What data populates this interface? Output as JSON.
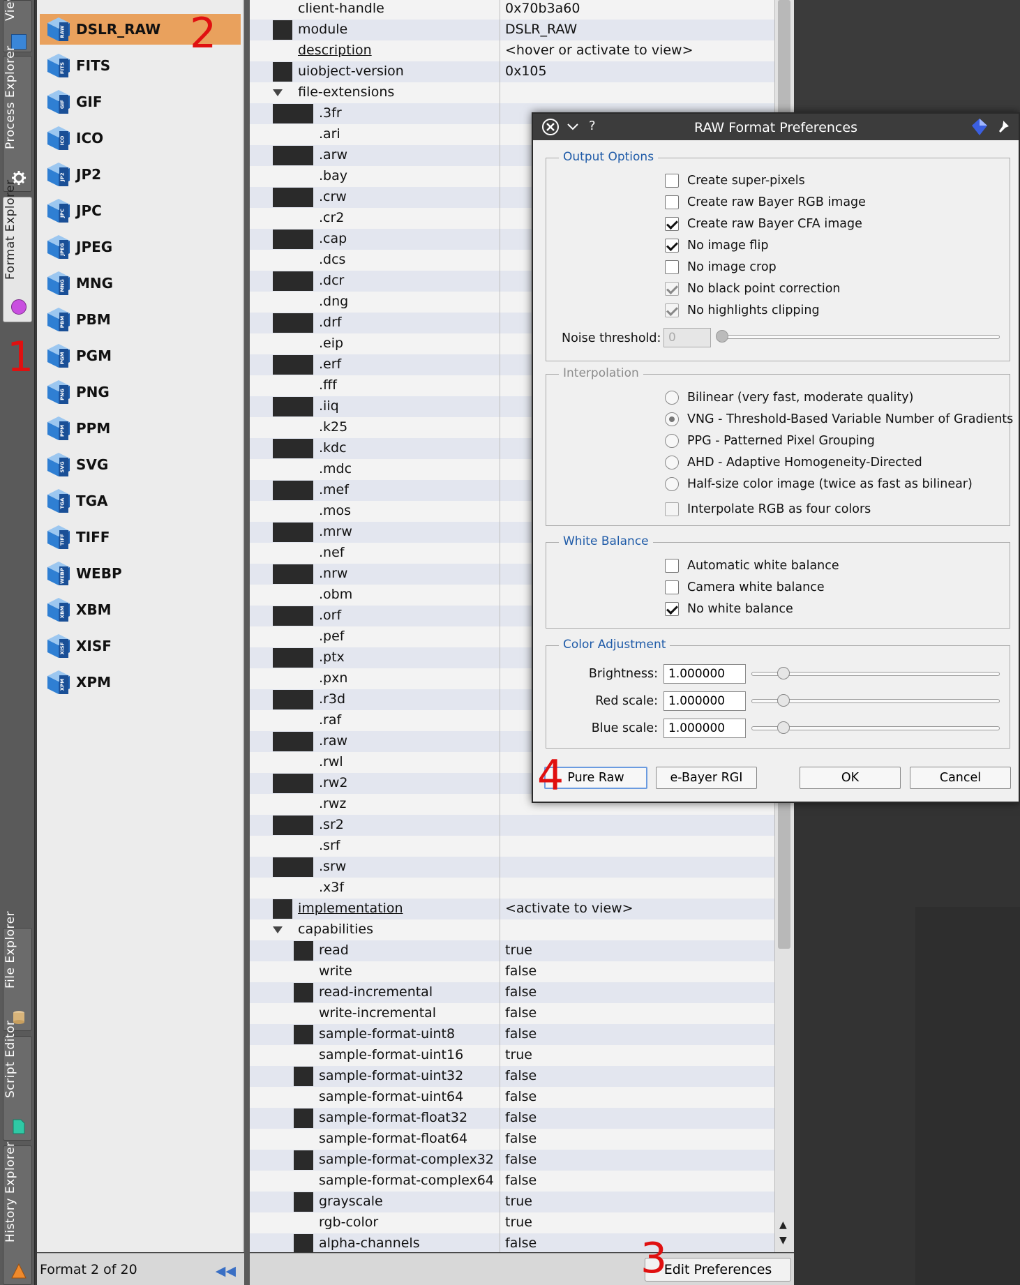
{
  "sidebar_tabs": {
    "view": "View E",
    "process_explorer": "Process Explorer",
    "format_explorer": "Format Explorer",
    "file_explorer": "File Explorer",
    "script_editor": "Script Editor",
    "history_explorer": "History Explorer"
  },
  "formats": [
    {
      "name": "DSLR_RAW",
      "badge": "RAW",
      "selected": true
    },
    {
      "name": "FITS",
      "badge": "FITS"
    },
    {
      "name": "GIF",
      "badge": "GIF"
    },
    {
      "name": "ICO",
      "badge": "ICO"
    },
    {
      "name": "JP2",
      "badge": "JP2"
    },
    {
      "name": "JPC",
      "badge": "JPC"
    },
    {
      "name": "JPEG",
      "badge": "JPEG"
    },
    {
      "name": "MNG",
      "badge": "MNG"
    },
    {
      "name": "PBM",
      "badge": "PBM"
    },
    {
      "name": "PGM",
      "badge": "PGM"
    },
    {
      "name": "PNG",
      "badge": "PNG"
    },
    {
      "name": "PPM",
      "badge": "PPM"
    },
    {
      "name": "SVG",
      "badge": "SVG"
    },
    {
      "name": "TGA",
      "badge": "TGA"
    },
    {
      "name": "TIFF",
      "badge": "TIFF"
    },
    {
      "name": "WEBP",
      "badge": "WEBP"
    },
    {
      "name": "XBM",
      "badge": "XBM"
    },
    {
      "name": "XISF",
      "badge": "XISF"
    },
    {
      "name": "XPM",
      "badge": "XPM"
    }
  ],
  "list_footer": "Format 2 of 20",
  "properties": [
    {
      "key": "client-handle",
      "value": "0x70b3a60",
      "level": 0
    },
    {
      "key": "module",
      "value": "DSLR_RAW",
      "level": 0,
      "swatch": true
    },
    {
      "key": "description",
      "value": "<hover or activate to view>",
      "level": 0,
      "link": true
    },
    {
      "key": "uiobject-version",
      "value": "0x105",
      "level": 0,
      "swatch": true
    },
    {
      "key": "file-extensions",
      "value": "",
      "level": 0,
      "expander": true
    },
    {
      "key": ".3fr",
      "value": "",
      "level": 1,
      "swatch": true
    },
    {
      "key": ".ari",
      "value": "",
      "level": 1
    },
    {
      "key": ".arw",
      "value": "",
      "level": 1,
      "swatch": true
    },
    {
      "key": ".bay",
      "value": "",
      "level": 1
    },
    {
      "key": ".crw",
      "value": "",
      "level": 1,
      "swatch": true
    },
    {
      "key": ".cr2",
      "value": "",
      "level": 1
    },
    {
      "key": ".cap",
      "value": "",
      "level": 1,
      "swatch": true
    },
    {
      "key": ".dcs",
      "value": "",
      "level": 1
    },
    {
      "key": ".dcr",
      "value": "",
      "level": 1,
      "swatch": true
    },
    {
      "key": ".dng",
      "value": "",
      "level": 1
    },
    {
      "key": ".drf",
      "value": "",
      "level": 1,
      "swatch": true
    },
    {
      "key": ".eip",
      "value": "",
      "level": 1
    },
    {
      "key": ".erf",
      "value": "",
      "level": 1,
      "swatch": true
    },
    {
      "key": ".fff",
      "value": "",
      "level": 1
    },
    {
      "key": ".iiq",
      "value": "",
      "level": 1,
      "swatch": true
    },
    {
      "key": ".k25",
      "value": "",
      "level": 1
    },
    {
      "key": ".kdc",
      "value": "",
      "level": 1,
      "swatch": true
    },
    {
      "key": ".mdc",
      "value": "",
      "level": 1
    },
    {
      "key": ".mef",
      "value": "",
      "level": 1,
      "swatch": true
    },
    {
      "key": ".mos",
      "value": "",
      "level": 1
    },
    {
      "key": ".mrw",
      "value": "",
      "level": 1,
      "swatch": true
    },
    {
      "key": ".nef",
      "value": "",
      "level": 1
    },
    {
      "key": ".nrw",
      "value": "",
      "level": 1,
      "swatch": true
    },
    {
      "key": ".obm",
      "value": "",
      "level": 1
    },
    {
      "key": ".orf",
      "value": "",
      "level": 1,
      "swatch": true
    },
    {
      "key": ".pef",
      "value": "",
      "level": 1
    },
    {
      "key": ".ptx",
      "value": "",
      "level": 1,
      "swatch": true
    },
    {
      "key": ".pxn",
      "value": "",
      "level": 1
    },
    {
      "key": ".r3d",
      "value": "",
      "level": 1,
      "swatch": true
    },
    {
      "key": ".raf",
      "value": "",
      "level": 1
    },
    {
      "key": ".raw",
      "value": "",
      "level": 1,
      "swatch": true
    },
    {
      "key": ".rwl",
      "value": "",
      "level": 1
    },
    {
      "key": ".rw2",
      "value": "",
      "level": 1,
      "swatch": true
    },
    {
      "key": ".rwz",
      "value": "",
      "level": 1
    },
    {
      "key": ".sr2",
      "value": "",
      "level": 1,
      "swatch": true
    },
    {
      "key": ".srf",
      "value": "",
      "level": 1
    },
    {
      "key": ".srw",
      "value": "",
      "level": 1,
      "swatch": true
    },
    {
      "key": ".x3f",
      "value": "",
      "level": 1
    },
    {
      "key": "implementation",
      "value": "<activate to view>",
      "level": 0,
      "swatch": true,
      "link": true
    },
    {
      "key": "capabilities",
      "value": "",
      "level": 0,
      "expander": true
    },
    {
      "key": "read",
      "value": "true",
      "level": 2,
      "swatch": true
    },
    {
      "key": "write",
      "value": "false",
      "level": 2
    },
    {
      "key": "read-incremental",
      "value": "false",
      "level": 2,
      "swatch": true
    },
    {
      "key": "write-incremental",
      "value": "false",
      "level": 2
    },
    {
      "key": "sample-format-uint8",
      "value": "false",
      "level": 2,
      "swatch": true
    },
    {
      "key": "sample-format-uint16",
      "value": "true",
      "level": 2
    },
    {
      "key": "sample-format-uint32",
      "value": "false",
      "level": 2,
      "swatch": true
    },
    {
      "key": "sample-format-uint64",
      "value": "false",
      "level": 2
    },
    {
      "key": "sample-format-float32",
      "value": "false",
      "level": 2,
      "swatch": true
    },
    {
      "key": "sample-format-float64",
      "value": "false",
      "level": 2
    },
    {
      "key": "sample-format-complex32",
      "value": "false",
      "level": 2,
      "swatch": true
    },
    {
      "key": "sample-format-complex64",
      "value": "false",
      "level": 2
    },
    {
      "key": "grayscale",
      "value": "true",
      "level": 2,
      "swatch": true
    },
    {
      "key": "rgb-color",
      "value": "true",
      "level": 2
    },
    {
      "key": "alpha-channels",
      "value": "false",
      "level": 2,
      "swatch": true
    }
  ],
  "edit_preferences_label": "Edit Preferences",
  "dialog": {
    "title": "RAW Format Preferences",
    "help": "?",
    "output_options": {
      "title": "Output Options",
      "items": [
        {
          "label": "Create super-pixels",
          "checked": false
        },
        {
          "label": "Create raw Bayer RGB image",
          "checked": false
        },
        {
          "label": "Create raw Bayer CFA image",
          "checked": true
        },
        {
          "label": "No image flip",
          "checked": true
        },
        {
          "label": "No image crop",
          "checked": false
        },
        {
          "label": "No black point correction",
          "checked": true,
          "disabled": true
        },
        {
          "label": "No highlights clipping",
          "checked": true,
          "disabled": true
        }
      ],
      "noise_label": "Noise threshold:",
      "noise_value": "0"
    },
    "interpolation": {
      "title": "Interpolation",
      "items": [
        {
          "label": "Bilinear (very fast, moderate quality)",
          "checked": false
        },
        {
          "label": "VNG - Threshold-Based Variable Number of Gradients",
          "checked": true
        },
        {
          "label": "PPG - Patterned Pixel Grouping",
          "checked": false
        },
        {
          "label": "AHD - Adaptive Homogeneity-Directed",
          "checked": false
        },
        {
          "label": "Half-size color image (twice as fast as bilinear)",
          "checked": false
        }
      ],
      "four_colors": "Interpolate RGB as four colors"
    },
    "white_balance": {
      "title": "White Balance",
      "items": [
        {
          "label": "Automatic white balance",
          "checked": false
        },
        {
          "label": "Camera white balance",
          "checked": false
        },
        {
          "label": "No white balance",
          "checked": true
        }
      ]
    },
    "color_adjustment": {
      "title": "Color Adjustment",
      "rows": [
        {
          "label": "Brightness:",
          "value": "1.000000"
        },
        {
          "label": "Red scale:",
          "value": "1.000000"
        },
        {
          "label": "Blue scale:",
          "value": "1.000000"
        }
      ]
    },
    "buttons": {
      "pure_raw": "Pure Raw",
      "debayer": "e-Bayer RGI",
      "ok": "OK",
      "cancel": "Cancel"
    }
  },
  "annotations": [
    "1",
    "2",
    "3",
    "4"
  ],
  "colors": {
    "selected_item": "#e9a15d",
    "group_title": "#1f5ba8",
    "annotation": "#e01010"
  }
}
